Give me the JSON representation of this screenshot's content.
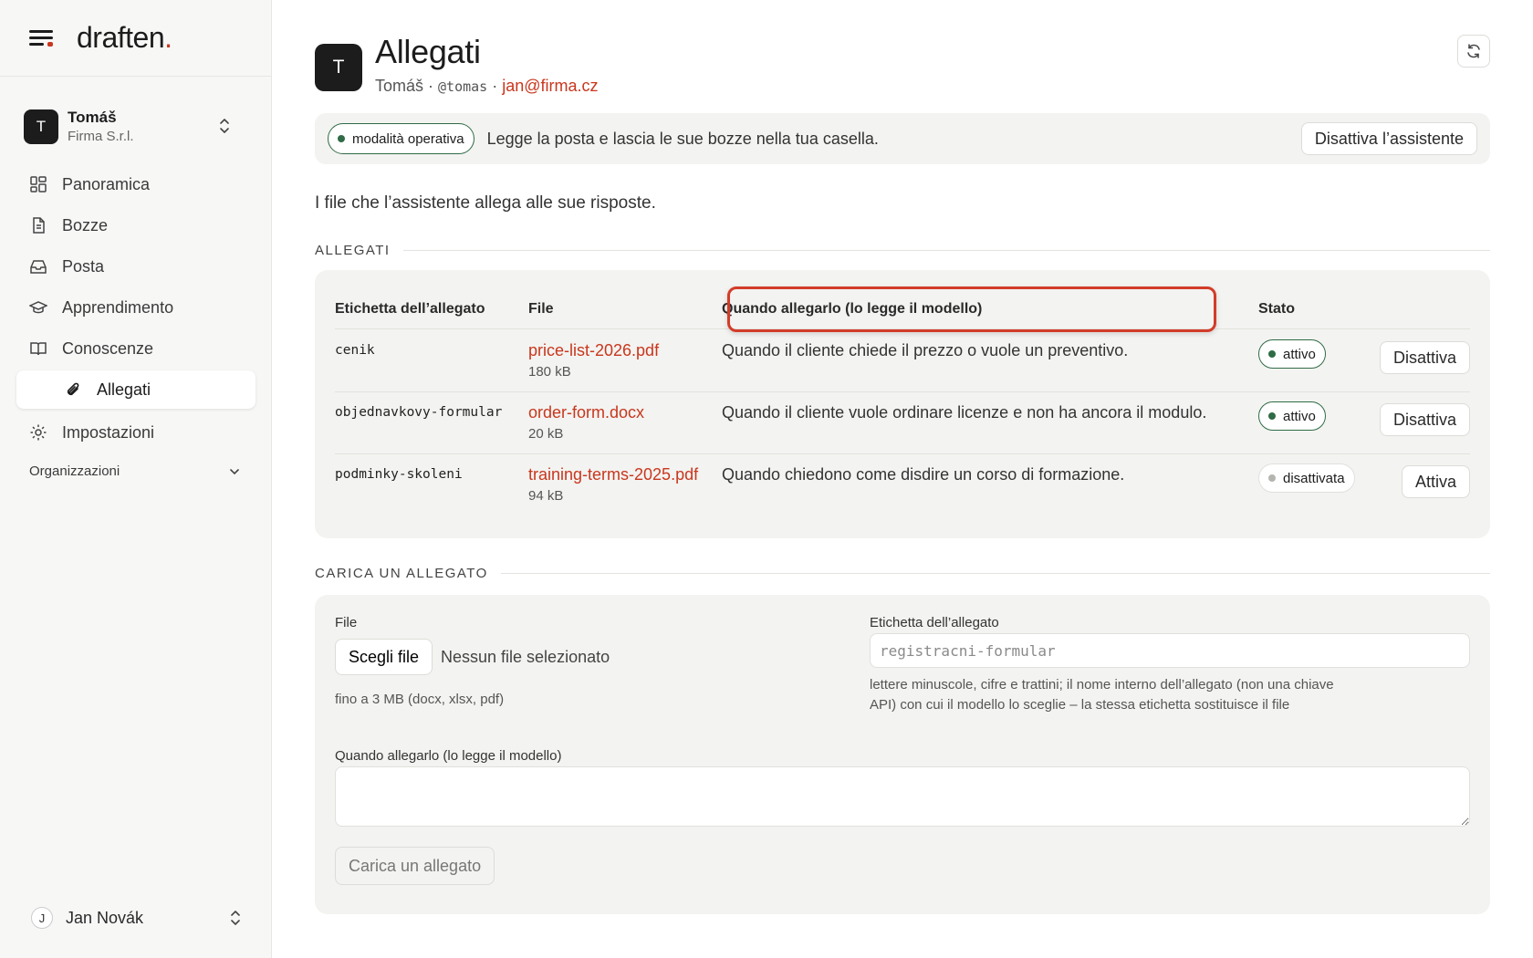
{
  "brand": {
    "name": "draften",
    "dot": "."
  },
  "org": {
    "avatar": "T",
    "name": "Tomáš",
    "company": "Firma S.r.l."
  },
  "nav": {
    "items": [
      {
        "label": "Panoramica",
        "icon": "dashboard-icon"
      },
      {
        "label": "Bozze",
        "icon": "document-icon"
      },
      {
        "label": "Posta",
        "icon": "inbox-icon"
      },
      {
        "label": "Apprendimento",
        "icon": "graduation-cap-icon"
      },
      {
        "label": "Conoscenze",
        "icon": "book-icon"
      }
    ],
    "active_sub": {
      "label": "Allegati",
      "icon": "paperclip-icon"
    },
    "settings": {
      "label": "Impostazioni",
      "icon": "gear-icon"
    },
    "group_label": "Organizzazioni"
  },
  "user": {
    "initial": "J",
    "name": "Jan Novák"
  },
  "header": {
    "avatar": "T",
    "title": "Allegati",
    "owner": "Tomáš",
    "sep": " · ",
    "handle": "@tomas",
    "email": "jan@firma.cz"
  },
  "banner": {
    "mode": "modalità operativa",
    "text": "Legge la posta e lascia le sue bozze nella tua casella.",
    "button": "Disattiva l’assistente"
  },
  "intro": "I file che l’assistente allega alle sue risposte.",
  "attachments_section": {
    "title": "ALLEGATI",
    "columns": {
      "label": "Etichetta dell’allegato",
      "file": "File",
      "when": "Quando allegarlo (lo legge il modello)",
      "state": "Stato"
    },
    "rows": [
      {
        "label": "cenik",
        "file": "price-list-2026.pdf",
        "size": "180 kB",
        "when": "Quando il cliente chiede il prezzo o vuole un preventivo.",
        "state": "attivo",
        "action": "Disattiva"
      },
      {
        "label": "objednavkovy-formular",
        "file": "order-form.docx",
        "size": "20 kB",
        "when": "Quando il cliente vuole ordinare licenze e non ha ancora il modulo.",
        "state": "attivo",
        "action": "Disattiva"
      },
      {
        "label": "podminky-skoleni",
        "file": "training-terms-2025.pdf",
        "size": "94 kB",
        "when": "Quando chiedono come disdire un corso di formazione.",
        "state": "disattivata",
        "action": "Attiva"
      }
    ]
  },
  "upload_section": {
    "title": "CARICA UN ALLEGATO",
    "file_label": "File",
    "choose_button": "Scegli file",
    "no_file": "Nessun file selezionato",
    "file_hint": "fino a 3 MB (docx, xlsx, pdf)",
    "label_label": "Etichetta dell’allegato",
    "label_placeholder": "registracni-formular",
    "label_hint": "lettere minuscole, cifre e trattini; il nome interno dell’allegato (non una chiave API) con cui il modello lo sceglie – la stessa etichetta sostituisce il file",
    "when_label": "Quando allegarlo (lo legge il modello)",
    "submit": "Carica un allegato"
  },
  "colors": {
    "accent": "#c8371d",
    "active_green": "#2f6b46",
    "inactive_gray": "#b5b5b0",
    "highlight": "#d23c28"
  }
}
